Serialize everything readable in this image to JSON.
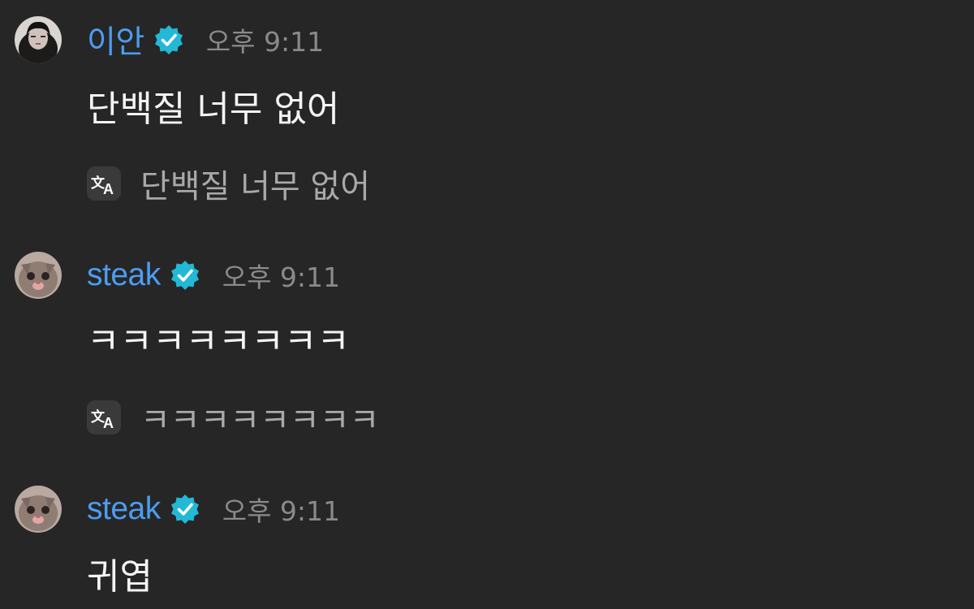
{
  "messages": [
    {
      "username": "이안",
      "time": "오후 9:11",
      "text": "단백질 너무 없어",
      "translation": "단백질 너무 없어"
    },
    {
      "username": "steak",
      "time": "오후 9:11",
      "text": "ㅋㅋㅋㅋㅋㅋㅋㅋ",
      "translation": "ㅋㅋㅋㅋㅋㅋㅋㅋ"
    },
    {
      "username": "steak",
      "time": "오후 9:11",
      "text": "귀엽"
    }
  ],
  "colors": {
    "background": "#262626",
    "username": "#4d9cf0",
    "verified_badge": "#22b8d6",
    "timestamp": "#8a8a8a",
    "message_text": "#f4f4f4",
    "translation_text": "#a9a9a9"
  },
  "icons": {
    "verified": "verified-badge-icon",
    "translate": "translate-icon"
  }
}
